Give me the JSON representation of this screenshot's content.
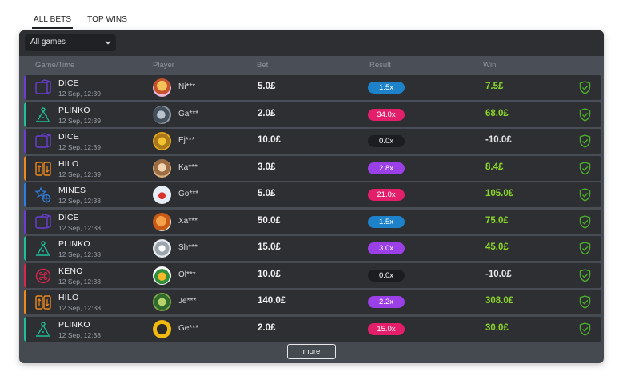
{
  "tabs": [
    {
      "label": "ALL BETS",
      "active": true
    },
    {
      "label": "TOP WINS",
      "active": false
    }
  ],
  "filter": {
    "selected": "All games"
  },
  "columns": {
    "game_time": "Game/Time",
    "player": "Player",
    "bet": "Bet",
    "result": "Result",
    "win": "Win"
  },
  "colors": {
    "dice": "#6a3fd1",
    "plinko": "#1fbf9a",
    "hilo": "#f08a1c",
    "mines": "#2f7de0",
    "keno": "#d8264e",
    "pill_blue": "#1d82c9",
    "pill_pink": "#e31f6b",
    "pill_purple": "#9b3fe6",
    "pill_black": "#1c1d20",
    "win_positive": "#8bd62a",
    "win_negative": "#e6e6e6",
    "shield": "#4caf2a"
  },
  "rows": [
    {
      "game": "DICE",
      "icon": "dice-icon",
      "time": "12 Sep, 12:39",
      "avatar": "avatar-icon",
      "player": "Ni***",
      "bet": "5.0£",
      "result": "1.5x",
      "pill": "pill_blue",
      "win": "7.5£",
      "win_color": "win_positive",
      "accent": "dice"
    },
    {
      "game": "PLINKO",
      "icon": "plinko-icon",
      "time": "12 Sep, 12:39",
      "avatar": "avatar-icon",
      "player": "Ga***",
      "bet": "2.0£",
      "result": "34.0x",
      "pill": "pill_pink",
      "win": "68.0£",
      "win_color": "win_positive",
      "accent": "plinko"
    },
    {
      "game": "DICE",
      "icon": "dice-icon",
      "time": "12 Sep, 12:39",
      "avatar": "avatar-icon",
      "player": "Ej***",
      "bet": "10.0£",
      "result": "0.0x",
      "pill": "pill_black",
      "win": "-10.0£",
      "win_color": "win_negative",
      "accent": "dice"
    },
    {
      "game": "HILO",
      "icon": "hilo-icon",
      "time": "12 Sep, 12:39",
      "avatar": "avatar-icon",
      "player": "Ka***",
      "bet": "3.0£",
      "result": "2.8x",
      "pill": "pill_purple",
      "win": "8.4£",
      "win_color": "win_positive",
      "accent": "hilo"
    },
    {
      "game": "MINES",
      "icon": "mines-icon",
      "time": "12 Sep, 12:38",
      "avatar": "avatar-icon",
      "player": "Go***",
      "bet": "5.0£",
      "result": "21.0x",
      "pill": "pill_pink",
      "win": "105.0£",
      "win_color": "win_positive",
      "accent": "mines"
    },
    {
      "game": "DICE",
      "icon": "dice-icon",
      "time": "12 Sep, 12:38",
      "avatar": "avatar-icon",
      "player": "Xa***",
      "bet": "50.0£",
      "result": "1.5x",
      "pill": "pill_blue",
      "win": "75.0£",
      "win_color": "win_positive",
      "accent": "dice"
    },
    {
      "game": "PLINKO",
      "icon": "plinko-icon",
      "time": "12 Sep, 12:38",
      "avatar": "avatar-icon",
      "player": "Sh***",
      "bet": "15.0£",
      "result": "3.0x",
      "pill": "pill_purple",
      "win": "45.0£",
      "win_color": "win_positive",
      "accent": "plinko"
    },
    {
      "game": "KENO",
      "icon": "keno-icon",
      "time": "12 Sep, 12:38",
      "avatar": "avatar-icon",
      "player": "Ol***",
      "bet": "10.0£",
      "result": "0.0x",
      "pill": "pill_black",
      "win": "-10.0£",
      "win_color": "win_negative",
      "accent": "keno"
    },
    {
      "game": "HILO",
      "icon": "hilo-icon",
      "time": "12 Sep, 12:38",
      "avatar": "avatar-icon",
      "player": "Je***",
      "bet": "140.0£",
      "result": "2.2x",
      "pill": "pill_purple",
      "win": "308.0£",
      "win_color": "win_positive",
      "accent": "hilo"
    },
    {
      "game": "PLINKO",
      "icon": "plinko-icon",
      "time": "12 Sep, 12:38",
      "avatar": "avatar-icon",
      "player": "Ge***",
      "bet": "2.0£",
      "result": "15.0x",
      "pill": "pill_pink",
      "win": "30.0£",
      "win_color": "win_positive",
      "accent": "plinko"
    }
  ],
  "more_label": "more"
}
